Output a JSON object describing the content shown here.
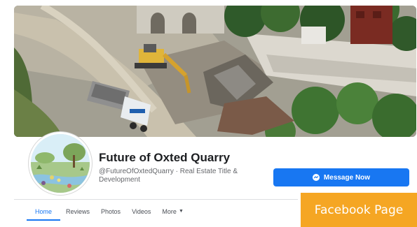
{
  "page": {
    "name": "Future of Oxted Quarry",
    "handle": "@FutureOfOxtedQuarry · Real Estate Title & Development"
  },
  "actions": {
    "message_label": "Message Now",
    "message_icon": "messenger-icon"
  },
  "tabs": [
    {
      "label": "Home",
      "active": true
    },
    {
      "label": "Reviews",
      "active": false
    },
    {
      "label": "Photos",
      "active": false
    },
    {
      "label": "Videos",
      "active": false
    },
    {
      "label": "More",
      "active": false,
      "dropdown": true
    }
  ],
  "badge": {
    "label": "Facebook Page",
    "color": "#f5a623"
  },
  "colors": {
    "accent": "#1877f2",
    "name_text": "#1c1e21",
    "secondary_text": "#65676b"
  }
}
